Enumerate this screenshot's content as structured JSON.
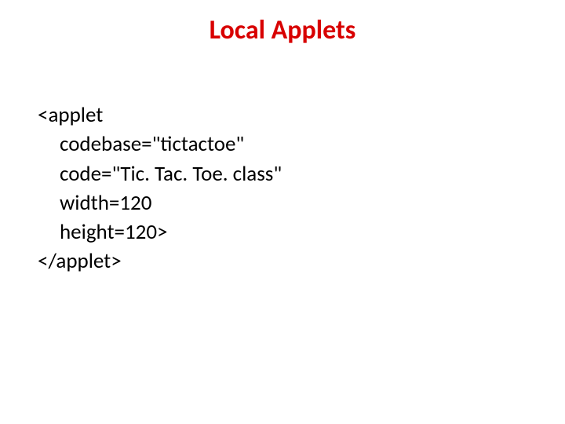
{
  "title": "Local Applets",
  "code": {
    "l0": "<applet",
    "l1": "codebase=\"tictactoe\"",
    "l2": "code=\"Tic. Tac. Toe. class\"",
    "l3": "width=120",
    "l4": "height=120>",
    "l5": "</applet>"
  }
}
